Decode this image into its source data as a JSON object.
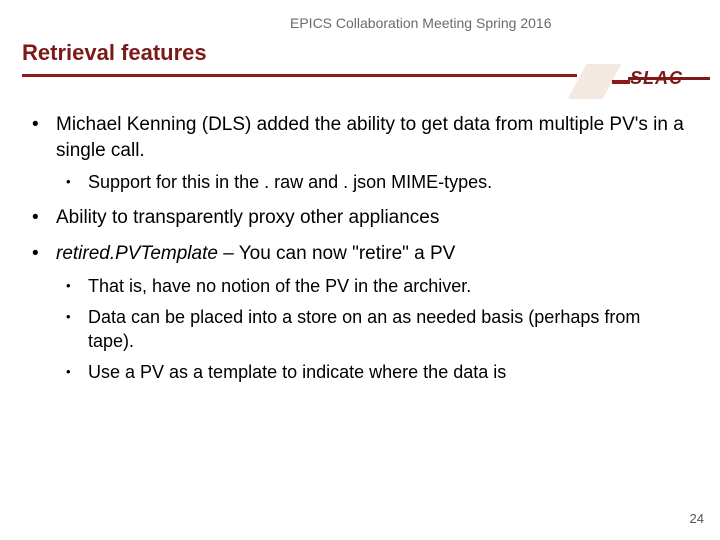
{
  "header": {
    "banner": "EPICS Collaboration Meeting Spring 2016"
  },
  "title": "Retrieval features",
  "logo": {
    "text": "SLAC"
  },
  "content": {
    "items": [
      {
        "text": "Michael Kenning (DLS) added the ability to get data from multiple PV's in a single call.",
        "sub": [
          {
            "text": "Support for this in the . raw and . json MIME-types."
          }
        ]
      },
      {
        "text": "Ability to transparently proxy other appliances",
        "sub": []
      },
      {
        "italic_prefix": "retired.PVTemplate",
        "text_rest": " – You can now \"retire\" a PV",
        "sub": [
          {
            "text": "That is, have no notion of the PV in the archiver."
          },
          {
            "text": "Data can be placed into a store on an as needed basis (perhaps from tape)."
          },
          {
            "text": "Use a PV as a template to indicate where the data is"
          }
        ]
      }
    ]
  },
  "page_number": "24"
}
